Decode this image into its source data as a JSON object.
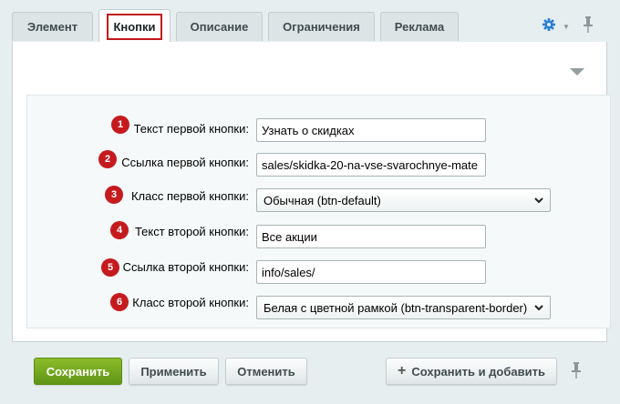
{
  "tabs": [
    {
      "label": "Элемент",
      "active": false
    },
    {
      "label": "Кнопки",
      "active": true
    },
    {
      "label": "Описание",
      "active": false
    },
    {
      "label": "Ограничения",
      "active": false
    },
    {
      "label": "Реклама",
      "active": false
    }
  ],
  "icons": {
    "settings": "gear-icon",
    "settings_dropdown": "caret-down-icon",
    "pin": "pin-icon",
    "collapse": "triangle-down-icon"
  },
  "colors": {
    "accent": "#c51b1f",
    "primary_button": "#72a81d",
    "gear": "#2b7fd4"
  },
  "form": {
    "rows": [
      {
        "number": "1",
        "label": "Текст первой кнопки:",
        "type": "text",
        "value": "Узнать о скидках"
      },
      {
        "number": "2",
        "label": "Ссылка первой кнопки:",
        "type": "text",
        "value": "sales/skidka-20-na-vse-svarochnye-mate"
      },
      {
        "number": "3",
        "label": "Класс первой кнопки:",
        "type": "select",
        "value": "Обычная (btn-default)"
      },
      {
        "number": "4",
        "label": "Текст второй кнопки:",
        "type": "text",
        "value": "Все акции"
      },
      {
        "number": "5",
        "label": "Ссылка второй кнопки:",
        "type": "text",
        "value": "info/sales/"
      },
      {
        "number": "6",
        "label": "Класс второй кнопки:",
        "type": "select",
        "value": "Белая с цветной рамкой (btn-transparent-border)"
      }
    ]
  },
  "footer": {
    "save": "Сохранить",
    "apply": "Применить",
    "cancel": "Отменить",
    "save_add": "Сохранить и добавить"
  }
}
